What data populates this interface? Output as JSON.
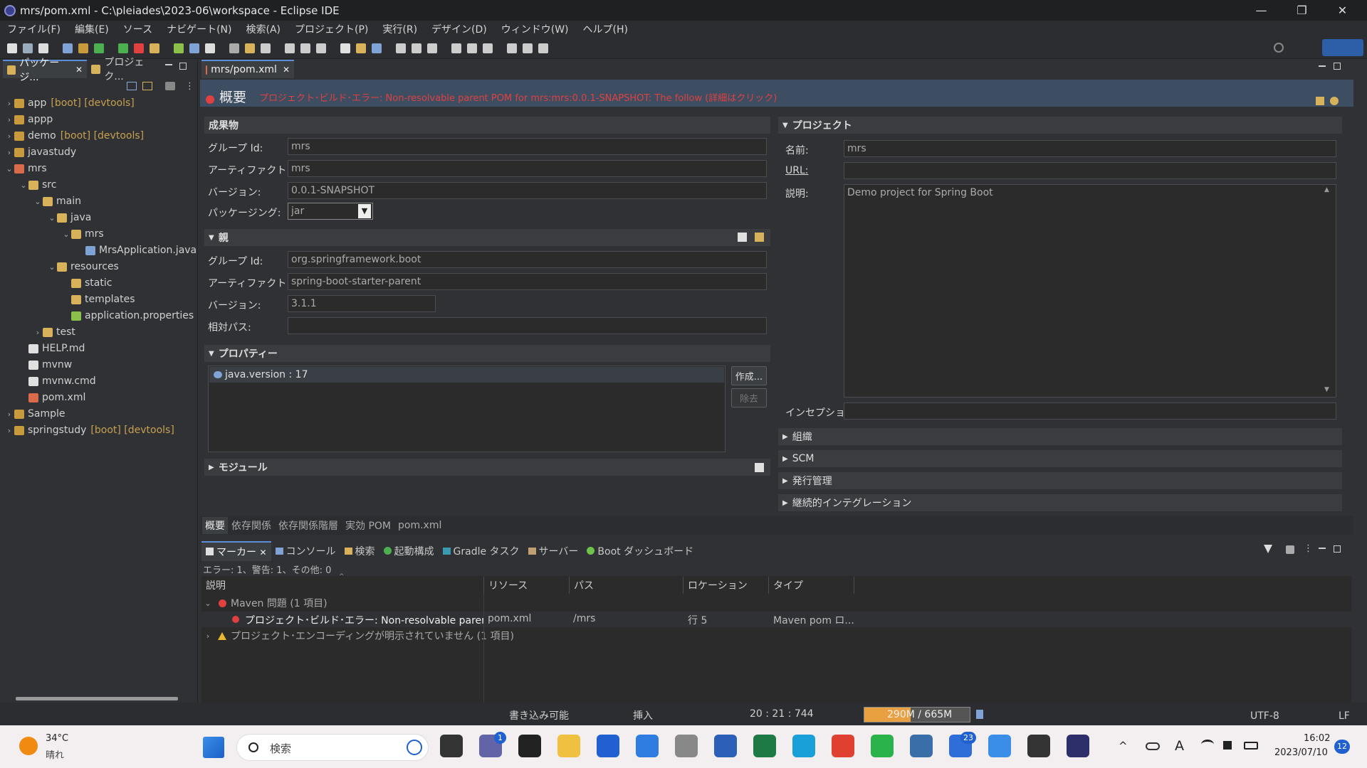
{
  "window": {
    "title": "mrs/pom.xml - C:\\pleiades\\2023-06\\workspace - Eclipse IDE"
  },
  "menu": [
    "ファイル(F)",
    "編集(E)",
    "ソース",
    "ナビゲート(N)",
    "検索(A)",
    "プロジェクト(P)",
    "実行(R)",
    "デザイン(D)",
    "ウィンドウ(W)",
    "ヘルプ(H)"
  ],
  "left_tabs": [
    "パッケージ...",
    "プロジェク..."
  ],
  "tree": [
    {
      "label": "app",
      "deco": "[boot] [devtools]",
      "indent": 0,
      "arrow": "›",
      "icon": "proj"
    },
    {
      "label": "appp",
      "deco": "",
      "indent": 0,
      "arrow": "›",
      "icon": "proj"
    },
    {
      "label": "demo",
      "deco": "[boot] [devtools]",
      "indent": 0,
      "arrow": "›",
      "icon": "proj"
    },
    {
      "label": "javastudy",
      "deco": "",
      "indent": 0,
      "arrow": "›",
      "icon": "proj"
    },
    {
      "label": "mrs",
      "deco": "",
      "indent": 0,
      "arrow": "⌄",
      "icon": "xml"
    },
    {
      "label": "src",
      "deco": "",
      "indent": 1,
      "arrow": "⌄",
      "icon": "fold"
    },
    {
      "label": "main",
      "deco": "",
      "indent": 2,
      "arrow": "⌄",
      "icon": "fold"
    },
    {
      "label": "java",
      "deco": "",
      "indent": 3,
      "arrow": "⌄",
      "icon": "fold"
    },
    {
      "label": "mrs",
      "deco": "",
      "indent": 4,
      "arrow": "⌄",
      "icon": "fold"
    },
    {
      "label": "MrsApplication.java",
      "deco": "",
      "indent": 5,
      "arrow": "",
      "icon": "java"
    },
    {
      "label": "resources",
      "deco": "",
      "indent": 3,
      "arrow": "⌄",
      "icon": "fold"
    },
    {
      "label": "static",
      "deco": "",
      "indent": 4,
      "arrow": "",
      "icon": "fold"
    },
    {
      "label": "templates",
      "deco": "",
      "indent": 4,
      "arrow": "",
      "icon": "fold"
    },
    {
      "label": "application.properties",
      "deco": "",
      "indent": 4,
      "arrow": "",
      "icon": "prop"
    },
    {
      "label": "test",
      "deco": "",
      "indent": 2,
      "arrow": "›",
      "icon": "fold"
    },
    {
      "label": "HELP.md",
      "deco": "",
      "indent": 1,
      "arrow": "",
      "icon": "file"
    },
    {
      "label": "mvnw",
      "deco": "",
      "indent": 1,
      "arrow": "",
      "icon": "file"
    },
    {
      "label": "mvnw.cmd",
      "deco": "",
      "indent": 1,
      "arrow": "",
      "icon": "file"
    },
    {
      "label": "pom.xml",
      "deco": "",
      "indent": 1,
      "arrow": "",
      "icon": "xml"
    },
    {
      "label": "Sample",
      "deco": "",
      "indent": 0,
      "arrow": "›",
      "icon": "proj"
    },
    {
      "label": "springstudy",
      "deco": "[boot] [devtools]",
      "indent": 0,
      "arrow": "›",
      "icon": "proj"
    }
  ],
  "editor": {
    "tab": "mrs/pom.xml",
    "header_title": "概要",
    "header_error": "プロジェクト･ビルド･エラー: Non-resolvable parent POM for mrs:mrs:0.0.1-SNAPSHOT: The follow (詳細はクリック)",
    "artifact": {
      "title": "成果物",
      "group_label": "グループ Id:",
      "group": "mrs",
      "artifact_label": "アーティファクト Id:",
      "artifact": "mrs",
      "version_label": "バージョン:",
      "version": "0.0.1-SNAPSHOT",
      "packaging_label": "パッケージング:",
      "packaging": "jar"
    },
    "parent": {
      "title": "親",
      "group_label": "グループ Id:",
      "group": "org.springframework.boot",
      "artifact_label": "アーティファクト Id:",
      "artifact": "spring-boot-starter-parent",
      "version_label": "バージョン:",
      "version": "3.1.1",
      "relpath_label": "相対パス:",
      "relpath": ""
    },
    "properties": {
      "title": "プロパティー",
      "item": "java.version : 17",
      "create": "作成...",
      "remove": "除去"
    },
    "modules": {
      "title": "モジュール"
    },
    "project": {
      "title": "プロジェクト",
      "name_label": "名前:",
      "name": "mrs",
      "url_label": "URL:",
      "url": "",
      "desc_label": "説明:",
      "desc": "Demo project for Spring Boot",
      "inception_label": "インセプション:",
      "inception": ""
    },
    "collapsed": [
      "組織",
      "SCM",
      "発行管理",
      "継続的インテグレーション"
    ],
    "bottom_tabs": [
      "概要",
      "依存関係",
      "依存関係階層",
      "実効 POM",
      "pom.xml"
    ]
  },
  "markers": {
    "tabs": [
      "マーカー",
      "コンソール",
      "検索",
      "起動構成",
      "Gradle タスク",
      "サーバー",
      "Boot ダッシュボード"
    ],
    "summary": "エラー: 1、警告: 1、その他: 0",
    "columns": [
      "説明",
      "リソース",
      "パス",
      "ロケーション",
      "タイプ"
    ],
    "group1": "Maven 問題 (1 項目)",
    "row1": {
      "desc": "プロジェクト･ビルド･エラー: Non-resolvable parent POM",
      "resource": "pom.xml",
      "path": "/mrs",
      "location": "行 5",
      "type": "Maven pom ロ..."
    },
    "group2": "プロジェクト･エンコーディングが明示されていません (1 項目)"
  },
  "status": {
    "writable": "書き込み可能",
    "insert": "挿入",
    "position": "20 : 21 : 744",
    "memory": "290M / 665M",
    "encoding": "UTF-8",
    "eol": "LF"
  },
  "taskbar": {
    "temp": "34°C",
    "weather": "晴れ",
    "search": "検索",
    "time": "16:02",
    "date": "2023/07/10",
    "notif": "12",
    "badge_chat": "1",
    "badge_teams": "23"
  },
  "colors": {
    "accent": "#5a8dd6",
    "error": "#e04040",
    "bg": "#2f3134"
  }
}
